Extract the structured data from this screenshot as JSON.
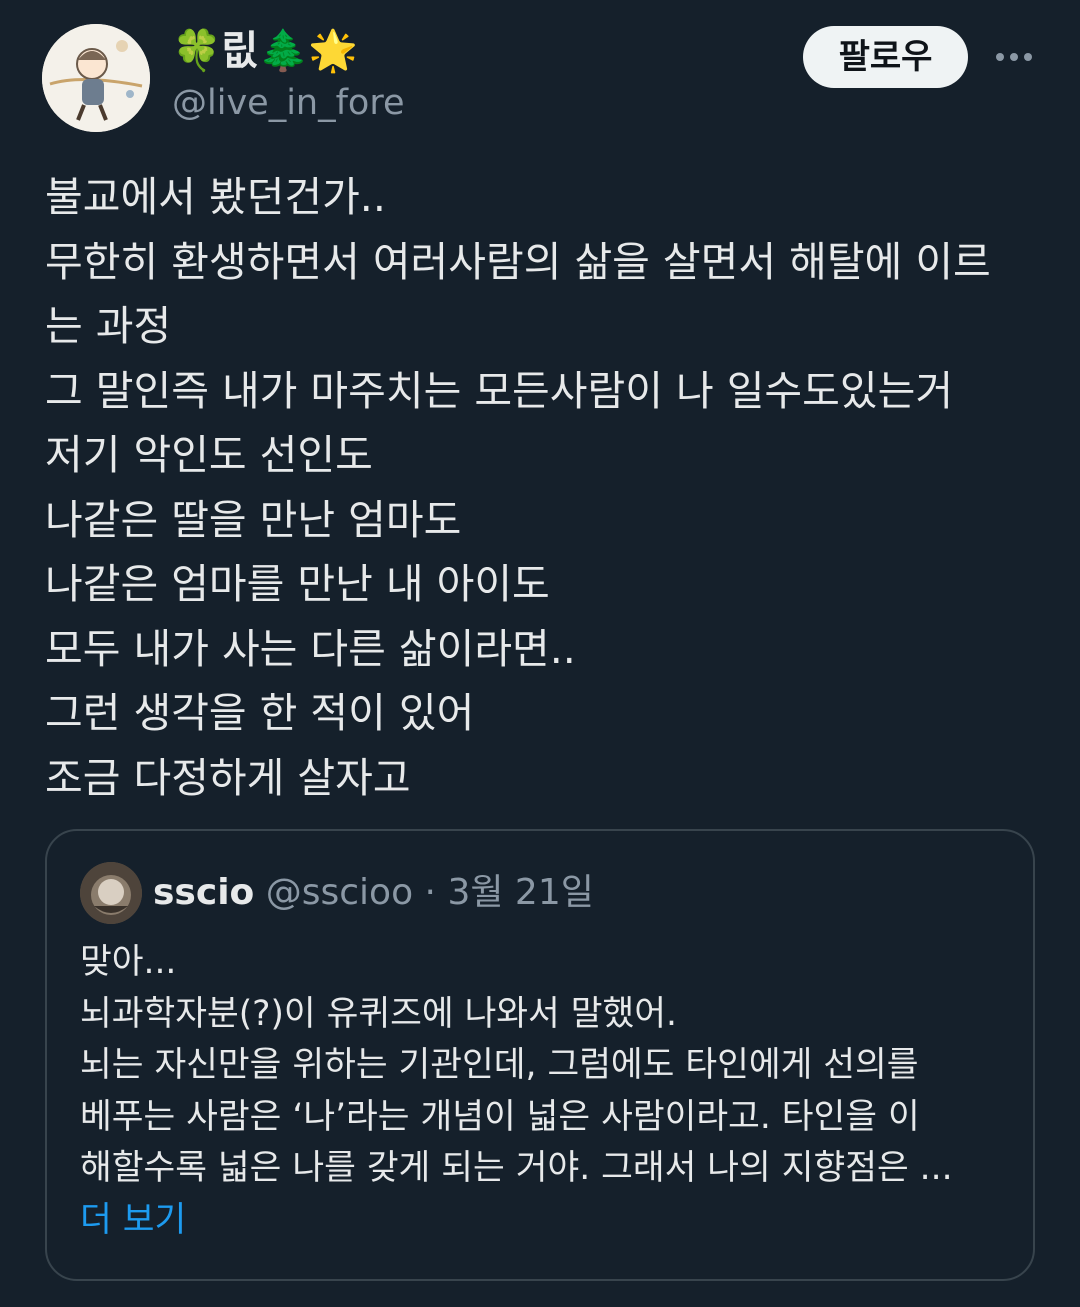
{
  "author": {
    "display_name": "🍀릾🌲🌟",
    "handle": "@live_in_fore"
  },
  "actions": {
    "follow_label": "팔로우",
    "more_icon": "more-horizontal-icon"
  },
  "tweet": {
    "lines": [
      "불교에서 봤던건가..",
      "무한히 환생하면서 여러사람의 삶을 살면서 해탈에 이르",
      "는 과정",
      "그 말인즉 내가 마주치는 모든사람이 나 일수도있는거",
      "저기 악인도 선인도",
      "나같은 딸을 만난 엄마도",
      "나같은 엄마를 만난 내 아이도",
      "모두 내가 사는 다른 삶이라면..",
      "그런 생각을 한 적이 있어",
      "조금 다정하게 살자고"
    ]
  },
  "quote": {
    "name": "sscio",
    "handle": "@sscioo",
    "separator": "·",
    "date": "3월 21일",
    "lines": [
      "맞아...",
      "뇌과학자분(?)이 유퀴즈에 나와서 말했어.",
      "뇌는 자신만을 위하는 기관인데, 그럼에도 타인에게 선의를",
      "베푸는 사람은 ‘나’라는 개념이 넓은 사람이라고. 타인을 이",
      "해할수록 넓은 나를 갖게 되는 거야. 그래서 나의 지향점은 ..."
    ],
    "show_more_label": "더 보기"
  },
  "colors": {
    "background": "#15202b",
    "text": "#e7e9ea",
    "secondary_text": "#8b98a5",
    "link": "#1d9bf0",
    "border": "#38444d",
    "button_bg": "#eff3f4",
    "button_text": "#0f1419"
  }
}
